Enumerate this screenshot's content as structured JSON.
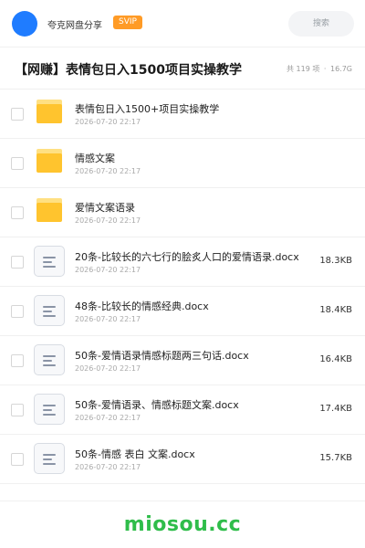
{
  "header": {
    "owner": "夸克网盘分享",
    "badge": "SVIP",
    "search_placeholder": "搜索",
    "accent_color": "#1f7cff",
    "badge_color": "#ff9b26"
  },
  "folder": {
    "title": "【网赚】表情包日入1500项目实操教学",
    "count_text": "共 119 项",
    "separator": "·",
    "total_size": "16.7G"
  },
  "items": [
    {
      "type": "folder",
      "icon": "folder-icon",
      "name": "表情包日入1500+项目实操教学",
      "date": "2026-07-20 22:17",
      "size": ""
    },
    {
      "type": "folder",
      "icon": "folder-icon",
      "name": "情感文案",
      "date": "2026-07-20 22:17",
      "size": ""
    },
    {
      "type": "folder",
      "icon": "folder-icon",
      "name": "爱情文案语录",
      "date": "2026-07-20 22:17",
      "size": ""
    },
    {
      "type": "file",
      "icon": "document-icon",
      "name": "20条-比较长的六七行的脍炙人口的爱情语录.docx",
      "date": "2026-07-20 22:17",
      "size": "18.3KB"
    },
    {
      "type": "file",
      "icon": "document-icon",
      "name": "48条-比较长的情感经典.docx",
      "date": "2026-07-20 22:17",
      "size": "18.4KB"
    },
    {
      "type": "file",
      "icon": "document-icon",
      "name": "50条-爱情语录情感标题两三句话.docx",
      "date": "2026-07-20 22:17",
      "size": "16.4KB"
    },
    {
      "type": "file",
      "icon": "document-icon",
      "name": "50条-爱情语录、情感标题文案.docx",
      "date": "2026-07-20 22:17",
      "size": "17.4KB"
    },
    {
      "type": "file",
      "icon": "document-icon",
      "name": "50条-情感 表白 文案.docx",
      "date": "2026-07-20 22:17",
      "size": "15.7KB"
    }
  ],
  "watermark": "miosou.cc"
}
